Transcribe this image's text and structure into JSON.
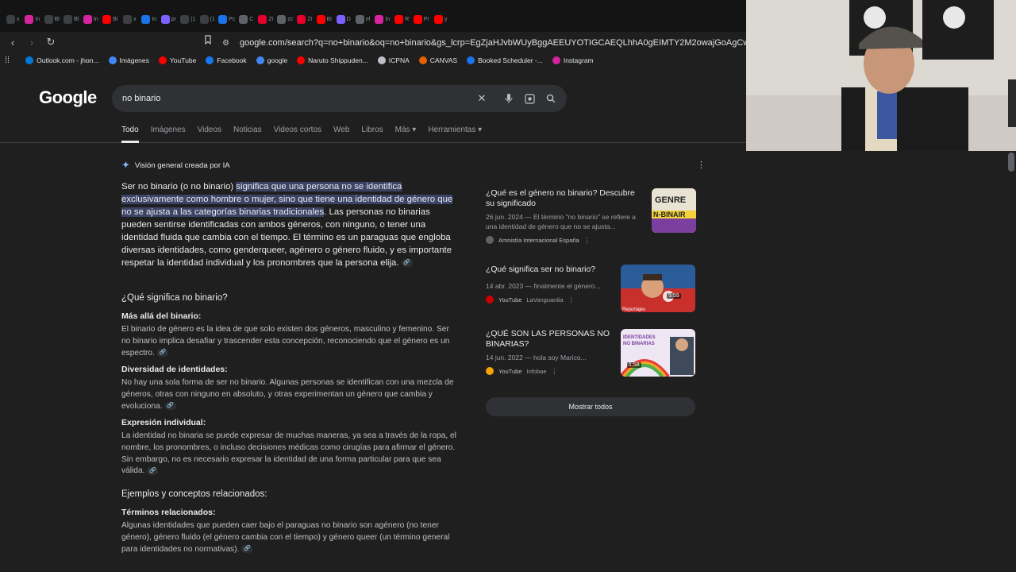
{
  "tabs": [
    {
      "label": "X",
      "color": "#3c4043",
      "short": "x"
    },
    {
      "label": "In",
      "color": "#d6249f",
      "short": "In"
    },
    {
      "label": "Bl",
      "color": "#3c4043",
      "short": "Bl"
    },
    {
      "label": "Bl",
      "color": "#3c4043",
      "short": "Bl"
    },
    {
      "label": "In",
      "color": "#d6249f",
      "short": "In"
    },
    {
      "label": "Bi",
      "color": "#ff0000",
      "short": "Bi"
    },
    {
      "label": "x",
      "color": "#3c4043",
      "short": "x"
    },
    {
      "label": "In",
      "color": "#1a73e8",
      "short": "In"
    },
    {
      "label": "pr",
      "color": "#7b61ff",
      "short": "pr"
    },
    {
      "label": "(1",
      "color": "#3c4043",
      "short": "(1"
    },
    {
      "label": "(1",
      "color": "#3c4043",
      "short": "(1"
    },
    {
      "label": "Pc",
      "color": "#1a73e8",
      "short": "Pc"
    },
    {
      "label": "C",
      "color": "#5f6368",
      "short": "C"
    },
    {
      "label": "Zi",
      "color": "#e8002d",
      "short": "Zi"
    },
    {
      "label": "zc",
      "color": "#5f6368",
      "short": "zc"
    },
    {
      "label": "Zi",
      "color": "#e8002d",
      "short": "Zi"
    },
    {
      "label": "Bi",
      "color": "#ff0000",
      "short": "Bi"
    },
    {
      "label": "D",
      "color": "#7b61ff",
      "short": "D"
    },
    {
      "label": "el",
      "color": "#5f6368",
      "short": "el"
    },
    {
      "label": "In",
      "color": "#d6249f",
      "short": "In"
    },
    {
      "label": "R",
      "color": "#ff0000",
      "short": "R"
    },
    {
      "label": "Pr",
      "color": "#ff0000",
      "short": "Pr"
    },
    {
      "label": "y",
      "color": "#ff0000",
      "short": "y"
    }
  ],
  "address": {
    "url": "google.com/search?q=no+binario&oq=no+binario&gs_lcrp=EgZjaHJvbWUyBggAEEUYOTIGCAEQLhhA0gEIMTY2M2owajGoAgCwAgA&sourceid=ch..."
  },
  "bookmarks": [
    {
      "label": "Outlook.com - jhon...",
      "color": "#0078d4"
    },
    {
      "label": "Imágenes",
      "color": "#4285f4"
    },
    {
      "label": "YouTube",
      "color": "#ff0000"
    },
    {
      "label": "Facebook",
      "color": "#1877f2"
    },
    {
      "label": "google",
      "color": "#4285f4"
    },
    {
      "label": "Naruto Shippuden...",
      "color": "#ff0000"
    },
    {
      "label": "ICPNA",
      "color": "#bdc1c6"
    },
    {
      "label": "CANVAS",
      "color": "#e66000"
    },
    {
      "label": "Booked Scheduler -...",
      "color": "#1a73e8"
    },
    {
      "label": "Instagram",
      "color": "#d6249f"
    }
  ],
  "google": {
    "logo": "Google",
    "query": "no binario",
    "search_tabs": [
      "Todo",
      "Imágenes",
      "Videos",
      "Noticias",
      "Videos cortos",
      "Web",
      "Libros",
      "Más ▾",
      "Herramientas ▾"
    ]
  },
  "ai": {
    "header": "Visión general creada por IA",
    "intro_plain": "Ser no binario (o no binario) ",
    "intro_highlight": "significa que una persona no se identifica exclusivamente como hombre o mujer, sino que tiene una identidad de género que no se ajusta a las categorías binarias tradicionales",
    "intro_rest": ". Las personas no binarias pueden sentirse identificadas con ambos géneros, con ninguno, o tener una identidad fluida que cambia con el tiempo. El término es un paraguas que engloba diversas identidades, como genderqueer, agénero o género fluido, y es importante respetar la identidad individual y los pronombres que la persona elija.",
    "q1": "¿Qué significa no binario?",
    "sub1": "Más allá del binario:",
    "text1": "El binario de género es la idea de que solo existen dos géneros, masculino y femenino. Ser no binario implica desafiar y trascender esta concepción, reconociendo que el género es un espectro.",
    "sub2": "Diversidad de identidades:",
    "text2": "No hay una sola forma de ser no binario. Algunas personas se identifican con una mezcla de géneros, otras con ninguno en absoluto, y otras experimentan un género que cambia y evoluciona.",
    "sub3": "Expresión individual:",
    "text3": "La identidad no binaria se puede expresar de muchas maneras, ya sea a través de la ropa, el nombre, los pronombres, o incluso decisiones médicas como cirugías para afirmar el género. Sin embargo, no es necesario expresar la identidad de una forma particular para que sea válida.",
    "q2": "Ejemplos y conceptos relacionados:",
    "sub4": "Términos relacionados:",
    "text4": "Algunas identidades que pueden caer bajo el paraguas no binario son agénero (no tener género), género fluido (el género cambia con el tiempo) y género queer (un término general para identidades no normativas)."
  },
  "cards": [
    {
      "title": "¿Qué es el género no binario? Descubre su significado",
      "snippet": "26 jun. 2024 — El término \"no binario\" se refiere a una identidad de género que no se ajusta...",
      "source": "Amnistía Internacional España",
      "source_color": "#5f6368",
      "thumb_text": "GENRE N-BINAIR"
    },
    {
      "title": "¿Qué significa ser no binario?",
      "snippet": "14 abr. 2023 — finalmente el género...",
      "source": "YouTube",
      "channel": "LaVanguardia",
      "source_color": "#ff0000",
      "duration": "5:59"
    },
    {
      "title": "¿QUÉ SON LAS PERSONAS NO BINARIAS?",
      "snippet": "14 jun. 2022 — hola soy Marico...",
      "source": "YouTube",
      "channel": "Infobae",
      "source_color": "#f4a300",
      "duration": "1:58",
      "thumb_text": "IDENTIDADES NO BINARIAS"
    }
  ],
  "show_all": "Mostrar todos"
}
